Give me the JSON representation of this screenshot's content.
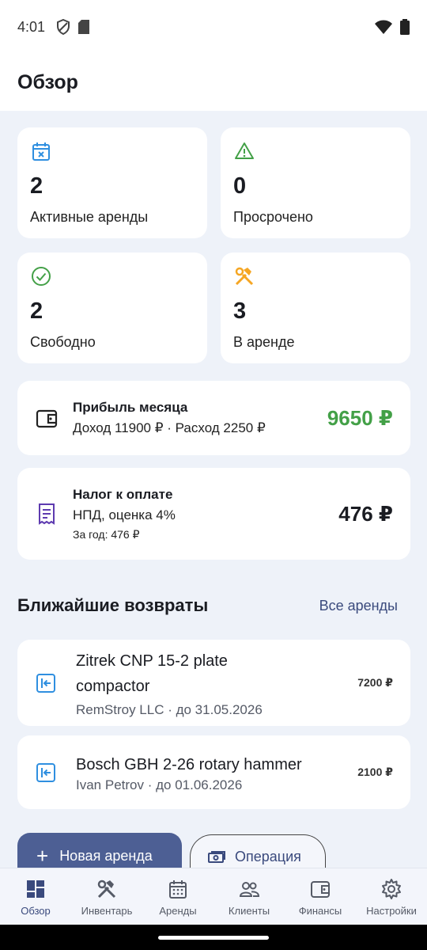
{
  "status_bar": {
    "time": "4:01"
  },
  "header": {
    "title": "Обзор"
  },
  "stats": [
    {
      "value": "2",
      "label": "Активные аренды",
      "icon": "calendar-x-icon",
      "color": "#2f8fe0"
    },
    {
      "value": "0",
      "label": "Просрочено",
      "icon": "warning-icon",
      "color": "#43a047"
    },
    {
      "value": "2",
      "label": "Свободно",
      "icon": "check-circle-icon",
      "color": "#43a047"
    },
    {
      "value": "3",
      "label": "В аренде",
      "icon": "tools-icon",
      "color": "#f5a623"
    }
  ],
  "profit": {
    "title": "Прибыль месяца",
    "subtitle": "Доход 11900 ₽ · Расход 2250 ₽",
    "amount": "9650 ₽",
    "amount_color": "#43a047",
    "icon": "wallet-icon"
  },
  "tax": {
    "title": "Налог к оплате",
    "subtitle": "НПД, оценка 4%",
    "year_note": "За год: 476 ₽",
    "amount": "476 ₽",
    "icon": "receipt-icon",
    "icon_color": "#5e3bb0"
  },
  "returns_section": {
    "title": "Ближайшие возвраты",
    "link": "Все аренды",
    "items": [
      {
        "name": "Zitrek CNP 15-2 plate compactor",
        "client": "RemStroy LLC · до 31.05.2026",
        "price": "7200 ₽"
      },
      {
        "name": "Bosch GBH 2-26 rotary hammer",
        "client": "Ivan Petrov · до 01.06.2026",
        "price": "2100 ₽"
      }
    ]
  },
  "actions": {
    "new_rental": "Новая аренда",
    "operation": "Операция"
  },
  "bottom_nav": [
    {
      "label": "Обзор",
      "icon": "dashboard-icon",
      "active": true
    },
    {
      "label": "Инвентарь",
      "icon": "tools-icon",
      "active": false
    },
    {
      "label": "Аренды",
      "icon": "calendar-icon",
      "active": false
    },
    {
      "label": "Клиенты",
      "icon": "people-icon",
      "active": false
    },
    {
      "label": "Финансы",
      "icon": "wallet-icon",
      "active": false
    },
    {
      "label": "Настройки",
      "icon": "gear-icon",
      "active": false
    }
  ],
  "colors": {
    "accent": "#4d5f94",
    "background": "#eef2f9",
    "link": "#3a4a7d"
  }
}
